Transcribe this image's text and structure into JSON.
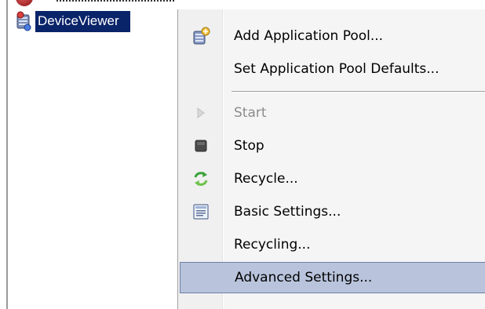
{
  "tree": {
    "selected_item": {
      "label": "DeviceViewer",
      "icon": "app-pool-icon"
    }
  },
  "context_menu": {
    "items": [
      {
        "label": "Add Application Pool...",
        "icon": "add-app-pool-icon",
        "enabled": true
      },
      {
        "label": "Set Application Pool Defaults...",
        "icon": "",
        "enabled": true
      },
      {
        "label": "Start",
        "icon": "play-icon",
        "enabled": false
      },
      {
        "label": "Stop",
        "icon": "stop-icon",
        "enabled": true
      },
      {
        "label": "Recycle...",
        "icon": "recycle-icon",
        "enabled": true
      },
      {
        "label": "Basic Settings...",
        "icon": "settings-doc-icon",
        "enabled": true
      },
      {
        "label": "Recycling...",
        "icon": "",
        "enabled": true
      },
      {
        "label": "Advanced Settings...",
        "icon": "",
        "enabled": true,
        "highlighted": true
      }
    ]
  },
  "colors": {
    "selection": "#0a246a",
    "menu_highlight": "#b9c4dc",
    "menu_highlight_border": "#6d7fa7",
    "disabled_text": "#8c8c8c"
  }
}
